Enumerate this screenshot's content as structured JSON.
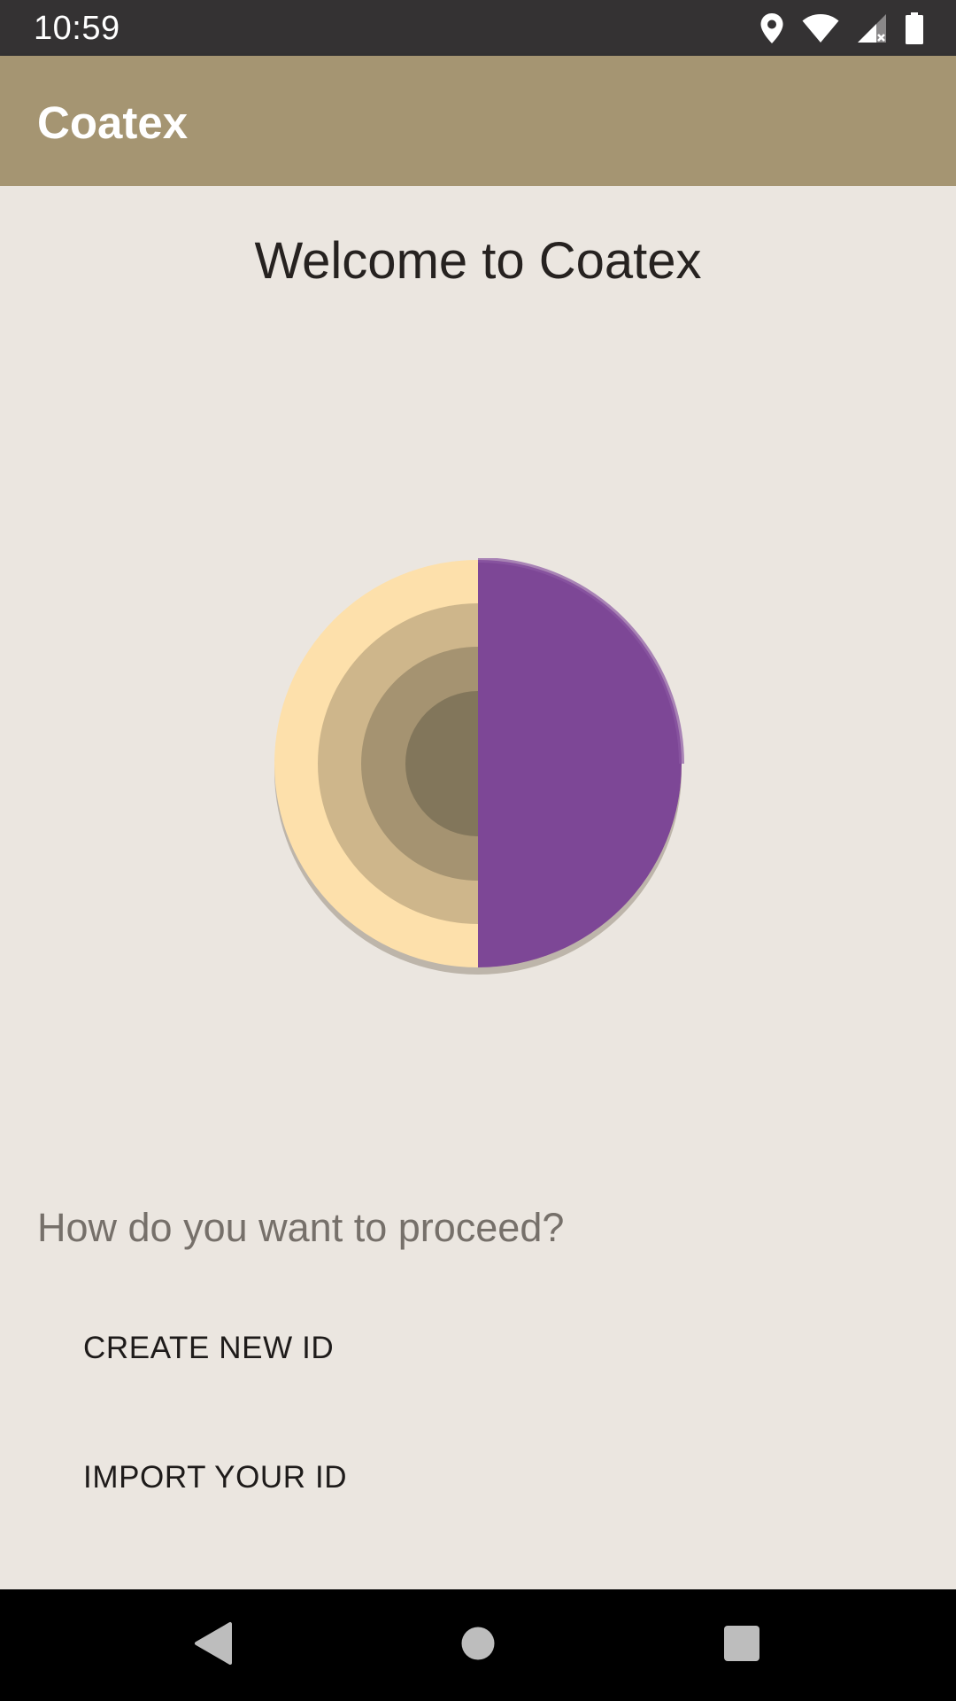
{
  "status_bar": {
    "time": "10:59",
    "icons": [
      "location-icon",
      "wifi-icon",
      "cell-signal-icon",
      "battery-icon"
    ]
  },
  "app_bar": {
    "title": "Coatex",
    "color": "#a59572"
  },
  "main": {
    "welcome_text": "Welcome to Coatex",
    "logo": {
      "left_ring_colors": [
        "#fde0ab",
        "#ceb68b",
        "#a59371",
        "#82765b"
      ],
      "right_half_color": "#7d4796"
    },
    "question": "How do you want to proceed?",
    "create_button_label": "CREATE NEW ID",
    "import_button_label": "IMPORT YOUR ID"
  },
  "nav_bar": {
    "buttons": [
      "back-icon",
      "home-icon",
      "recents-icon"
    ]
  }
}
